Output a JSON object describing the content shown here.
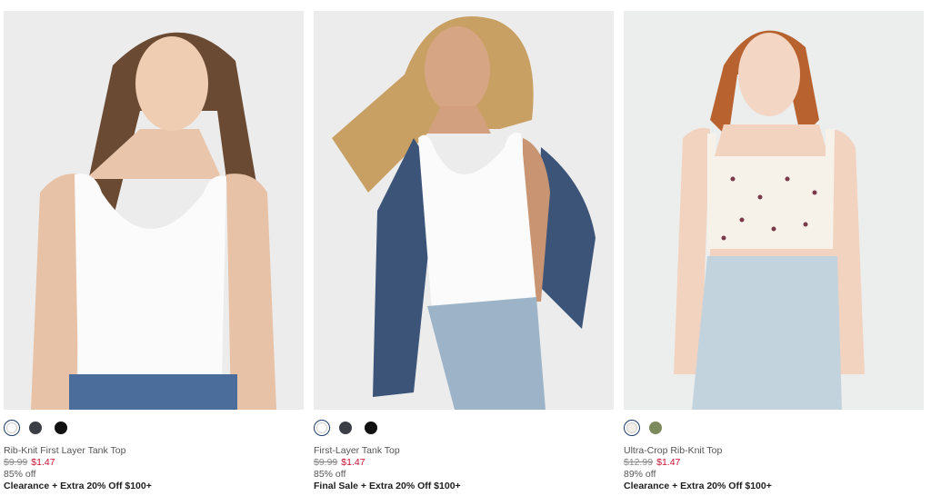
{
  "products": [
    {
      "name": "Rib-Knit First Layer Tank Top",
      "original_price": "$9.99",
      "sale_price": "$1.47",
      "discount": "85% off",
      "promo": "Clearance + Extra 20% Off $100+",
      "swatches": [
        {
          "color": "#ffffff",
          "label": "white-swatch",
          "selected": true
        },
        {
          "color": "#3b3f45",
          "label": "charcoal-swatch",
          "selected": false
        },
        {
          "color": "#111111",
          "label": "black-swatch",
          "selected": false
        }
      ]
    },
    {
      "name": "First-Layer Tank Top",
      "original_price": "$9.99",
      "sale_price": "$1.47",
      "discount": "85% off",
      "promo": "Final Sale + Extra 20% Off $100+",
      "swatches": [
        {
          "color": "#ffffff",
          "label": "white-swatch",
          "selected": true
        },
        {
          "color": "#3b3f45",
          "label": "charcoal-swatch",
          "selected": false
        },
        {
          "color": "#111111",
          "label": "black-swatch",
          "selected": false
        }
      ]
    },
    {
      "name": "Ultra-Crop Rib-Knit Top",
      "original_price": "$12.99",
      "sale_price": "$1.47",
      "discount": "89% off",
      "promo": "Clearance + Extra 20% Off $100+",
      "swatches": [
        {
          "color": "#f3efe6",
          "label": "floral-print-swatch",
          "selected": true
        },
        {
          "color": "#7d8a5e",
          "label": "olive-swatch",
          "selected": false
        }
      ]
    }
  ],
  "colors": {
    "sale_red": "#c8102e",
    "selected_ring": "#1c3c6b",
    "photo_background": "#ececec"
  }
}
